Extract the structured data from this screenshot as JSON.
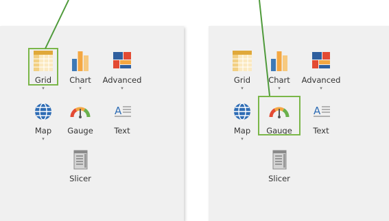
{
  "panels": [
    {
      "id": "left",
      "items": [
        {
          "key": "grid",
          "label": "Grid",
          "dropdown": true,
          "icon": "grid-icon"
        },
        {
          "key": "chart",
          "label": "Chart",
          "dropdown": true,
          "icon": "bar-chart-icon"
        },
        {
          "key": "advanced",
          "label": "Advanced",
          "dropdown": true,
          "icon": "advanced-icon"
        },
        {
          "key": "map",
          "label": "Map",
          "dropdown": true,
          "icon": "globe-icon"
        },
        {
          "key": "gauge",
          "label": "Gauge",
          "dropdown": false,
          "icon": "gauge-icon"
        },
        {
          "key": "text",
          "label": "Text",
          "dropdown": false,
          "icon": "text-icon"
        },
        {
          "key": "slicer",
          "label": "Slicer",
          "dropdown": false,
          "icon": "slicer-icon"
        }
      ],
      "highlighted": "grid"
    },
    {
      "id": "right",
      "items": [
        {
          "key": "grid",
          "label": "Grid",
          "dropdown": true,
          "icon": "grid-icon"
        },
        {
          "key": "chart",
          "label": "Chart",
          "dropdown": true,
          "icon": "bar-chart-icon"
        },
        {
          "key": "advanced",
          "label": "Advanced",
          "dropdown": true,
          "icon": "advanced-icon"
        },
        {
          "key": "map",
          "label": "Map",
          "dropdown": true,
          "icon": "globe-icon"
        },
        {
          "key": "gauge",
          "label": "Gauge",
          "dropdown": false,
          "icon": "gauge-icon"
        },
        {
          "key": "text",
          "label": "Text",
          "dropdown": false,
          "icon": "text-icon"
        },
        {
          "key": "slicer",
          "label": "Slicer",
          "dropdown": false,
          "icon": "slicer-icon"
        }
      ],
      "highlighted": "gauge"
    }
  ],
  "dropdown_glyph": "▾",
  "colors": {
    "panel_bg": "#f0f0f0",
    "highlight": "#7ab648",
    "callout_line": "#4e9a3a"
  }
}
